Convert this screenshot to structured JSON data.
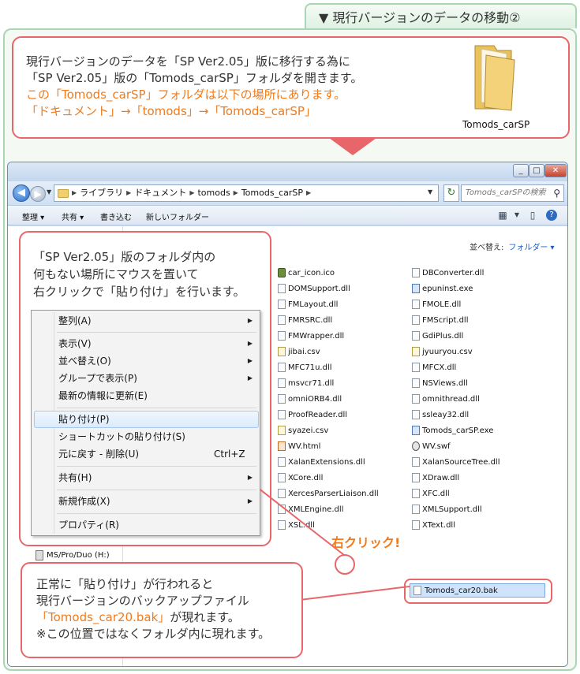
{
  "header": {
    "title": "▼ 現行バージョンのデータの移動②"
  },
  "top_callout": {
    "line1": "現行バージョンのデータを「SP Ver2.05」版に移行する為に",
    "line2": "「SP Ver2.05」版の「Tomods_carSP」フォルダを開きます。",
    "line3": "この「Tomods_carSP」フォルダは以下の場所にあります。",
    "line4": "「ドキュメント」→「tomods」→「Tomods_carSP」",
    "folder_label": "Tomods_carSP"
  },
  "window": {
    "address": [
      "ライブラリ",
      "ドキュメント",
      "tomods",
      "Tomods_carSP"
    ],
    "search_placeholder": "Tomods_carSPの検索",
    "toolbar": {
      "organize": "整理 ▾",
      "share": "共有 ▾",
      "burn": "書き込む",
      "new_folder": "新しいフォルダー"
    },
    "sort_label": "並べ替え:",
    "sort_value": "フォルダー ▾",
    "files_left": [
      {
        "name": "car_icon.ico",
        "type": "ico"
      },
      {
        "name": "DOMSupport.dll",
        "type": "dll"
      },
      {
        "name": "FMLayout.dll",
        "type": "dll"
      },
      {
        "name": "FMRSRC.dll",
        "type": "dll"
      },
      {
        "name": "FMWrapper.dll",
        "type": "dll"
      },
      {
        "name": "jibai.csv",
        "type": "csv"
      },
      {
        "name": "MFC71u.dll",
        "type": "dll"
      },
      {
        "name": "msvcr71.dll",
        "type": "dll"
      },
      {
        "name": "omniORB4.dll",
        "type": "dll"
      },
      {
        "name": "ProofReader.dll",
        "type": "dll"
      },
      {
        "name": "syazei.csv",
        "type": "csv"
      },
      {
        "name": "WV.html",
        "type": "html"
      },
      {
        "name": "XalanExtensions.dll",
        "type": "dll"
      },
      {
        "name": "XCore.dll",
        "type": "dll"
      },
      {
        "name": "XercesParserLiaison.dll",
        "type": "dll"
      },
      {
        "name": "XMLEngine.dll",
        "type": "dll"
      },
      {
        "name": "XSL.dll",
        "type": "dll"
      }
    ],
    "files_right": [
      {
        "name": "DBConverter.dll",
        "type": "dll"
      },
      {
        "name": "epuninst.exe",
        "type": "exe"
      },
      {
        "name": "FMOLE.dll",
        "type": "dll"
      },
      {
        "name": "FMScript.dll",
        "type": "dll"
      },
      {
        "name": "GdiPlus.dll",
        "type": "dll"
      },
      {
        "name": "jyuuryou.csv",
        "type": "csv"
      },
      {
        "name": "MFCX.dll",
        "type": "dll"
      },
      {
        "name": "NSViews.dll",
        "type": "dll"
      },
      {
        "name": "omnithread.dll",
        "type": "dll"
      },
      {
        "name": "ssleay32.dll",
        "type": "dll"
      },
      {
        "name": "Tomods_carSP.exe",
        "type": "exe"
      },
      {
        "name": "WV.swf",
        "type": "swf"
      },
      {
        "name": "XalanSourceTree.dll",
        "type": "dll"
      },
      {
        "name": "XDraw.dll",
        "type": "dll"
      },
      {
        "name": "XFC.dll",
        "type": "dll"
      },
      {
        "name": "XMLSupport.dll",
        "type": "dll"
      },
      {
        "name": "XText.dll",
        "type": "dll"
      }
    ],
    "bak_file": "Tomods_car20.bak",
    "drive": "MS/Pro/Duo (H:)"
  },
  "left_callout": {
    "line1": "「SP Ver2.05」版のフォルダ内の",
    "line2": "何もない場所にマウスを置いて",
    "line3": "右クリックで「貼り付け」を行います。"
  },
  "context_menu": {
    "arrange": "整列(A)",
    "view": "表示(V)",
    "sort": "並べ替え(O)",
    "group": "グループで表示(P)",
    "refresh": "最新の情報に更新(E)",
    "paste": "貼り付け(P)",
    "paste_shortcut": "ショートカットの貼り付け(S)",
    "undo": "元に戻す - 削除(U)",
    "undo_shortcut": "Ctrl+Z",
    "share": "共有(H)",
    "new": "新規作成(X)",
    "properties": "プロパティ(R)"
  },
  "annotation": {
    "right_click": "右クリック!"
  },
  "bottom_callout": {
    "line1": "正常に「貼り付け」が行われると",
    "line2": "現行バージョンのバックアップファイル",
    "line3a": "「Tomods_car20.bak」",
    "line3b": "が現れます。",
    "line4": "※この位置ではなくフォルダ内に現れます。"
  },
  "colors": {
    "accent_red": "#e8666a",
    "orange_text": "#f07b1d",
    "frame_green": "#a9d6b5"
  }
}
